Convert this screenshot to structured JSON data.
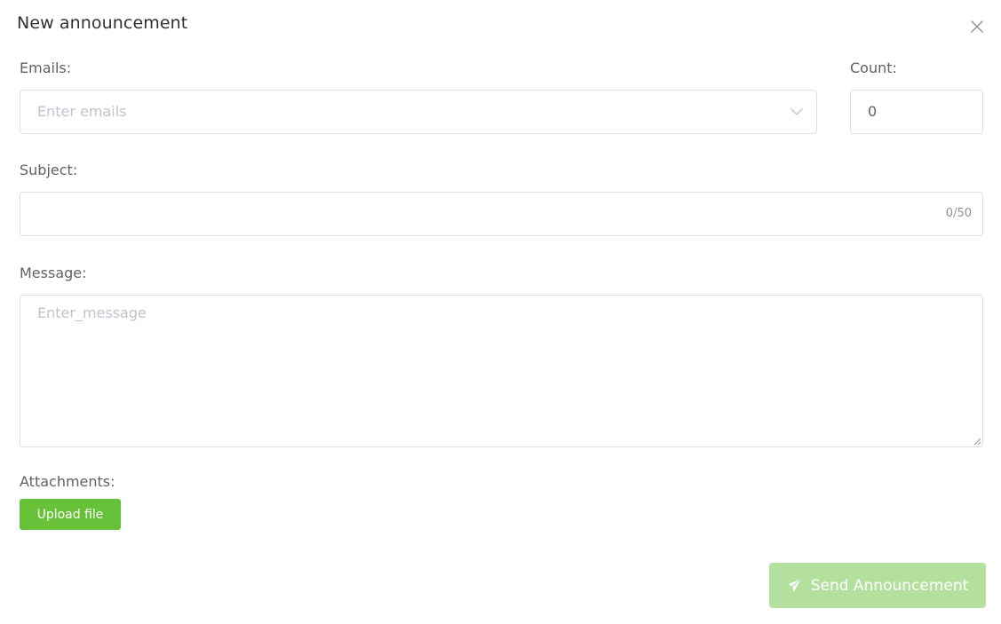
{
  "dialog": {
    "title": "New announcement",
    "close_icon": "close-icon"
  },
  "emails": {
    "label": "Emails:",
    "placeholder": "Enter emails",
    "dropdown_icon": "chevron-down-icon"
  },
  "count": {
    "label": "Count:",
    "value": "0"
  },
  "subject": {
    "label": "Subject:",
    "value": "",
    "counter": "0/50"
  },
  "message": {
    "label": "Message:",
    "placeholder": "Enter_message",
    "value": ""
  },
  "attachments": {
    "label": "Attachments:",
    "upload_label": "Upload file"
  },
  "send": {
    "label": "Send Announcement",
    "icon": "paper-plane-icon",
    "disabled": true
  },
  "colors": {
    "primary_green": "#67c23a",
    "disabled_green": "#b3e19d",
    "border": "#dcdfe6",
    "placeholder": "#c0c4cc",
    "text": "#606266"
  }
}
